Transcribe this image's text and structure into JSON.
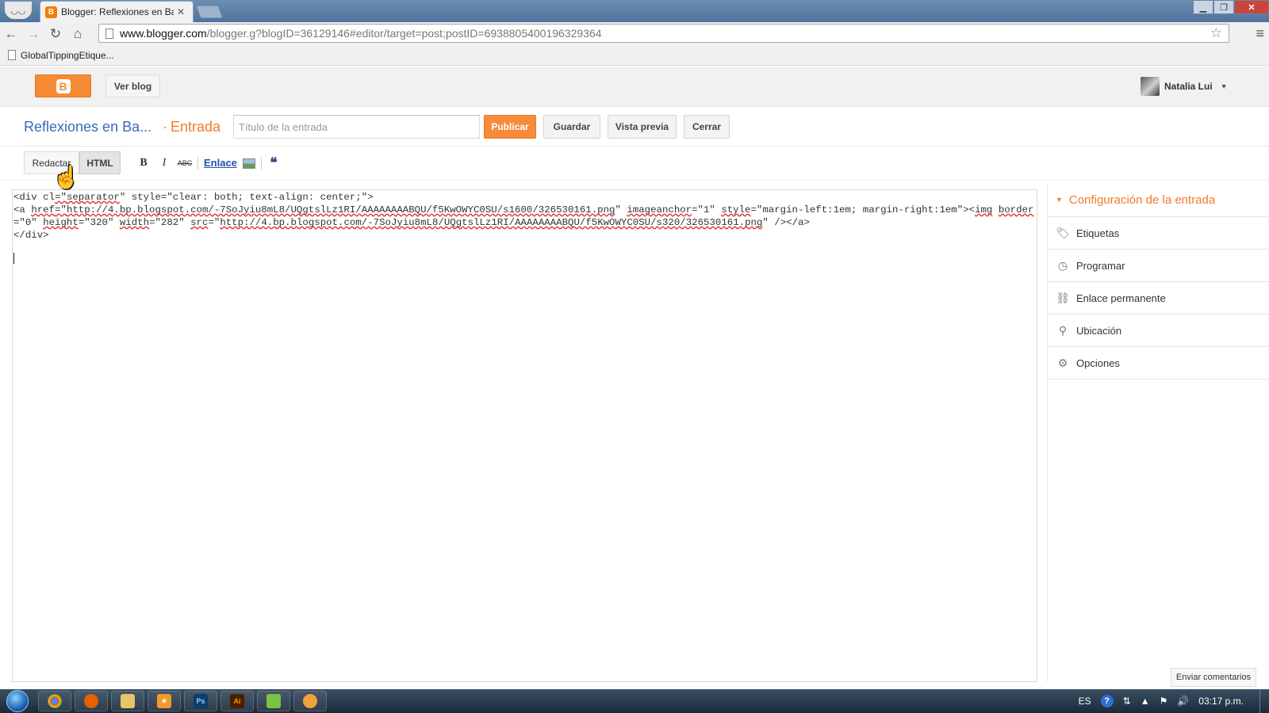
{
  "browser": {
    "tab_title": "Blogger: Reflexiones en Ba",
    "url_host": "www.blogger.com",
    "url_path": "/blogger.g?blogID=36129146#editor/target=post;postID=6938805400196329364",
    "bookmark": "GlobalTippingEtique..."
  },
  "header": {
    "view_blog": "Ver blog",
    "user_name": "Natalia Lui"
  },
  "post_bar": {
    "blog_name": "Reflexiones en Ba...",
    "separator": "·",
    "post_type": "Entrada",
    "title_placeholder": "Título de la entrada",
    "title_value": "",
    "publish": "Publicar",
    "save": "Guardar",
    "preview": "Vista previa",
    "close": "Cerrar"
  },
  "editor_toolbar": {
    "compose": "Redactar",
    "html": "HTML",
    "bold": "B",
    "italic": "I",
    "strike": "ABC",
    "link": "Enlace",
    "quote": "❝"
  },
  "source": {
    "l1a": "<div cl",
    "l1b": "=\"",
    "l1c": "separator",
    "l1d": "\" style=\"clear: both; text-align: center;\">\n<a ",
    "href_attr": "href",
    "q1": "=\"",
    "url1": "http://4.bp.blogspot.com/-7SoJyiu8mL8/UQgtslLz1RI/AAAAAAAABQU/f5KwOWYC0SU/s1600/326530161.png",
    "q2": "\" ",
    "imageanchor": "imageanchor",
    "q3": "=\"1\" ",
    "style_attr": "style",
    "style_val": "=\"margin-left:1em; margin-right:1em\"><",
    "img_tag": "img",
    "sp1": " ",
    "border_attr": "border",
    "border_val": "=\"0\" ",
    "height_attr": "height",
    "height_val": "=\"320\" ",
    "width_attr": "width",
    "width_val": "=\"282\" ",
    "src_attr": "src",
    "q4": "=\"",
    "url2": "http://4.bp.blogspot.com/-7SoJyiu8mL8/UQgtslLz1RI/AAAAAAAABQU/f5KwOWYC0SU/s320/326530161.png",
    "end": "\" /></a>\n</div>"
  },
  "sidebar": {
    "title": "Configuración de la entrada",
    "items": [
      {
        "label": "Etiquetas",
        "icon": "tag-icon"
      },
      {
        "label": "Programar",
        "icon": "clock-icon"
      },
      {
        "label": "Enlace permanente",
        "icon": "link-icon"
      },
      {
        "label": "Ubicación",
        "icon": "location-pin-icon"
      },
      {
        "label": "Opciones",
        "icon": "gear-icon"
      }
    ]
  },
  "feedback": "Enviar comentarios",
  "taskbar": {
    "language": "ES",
    "help": "?",
    "clock": "03:17 p.m."
  },
  "colors": {
    "blogger_orange": "#f68b3c",
    "link_blue": "#3a6ab7",
    "accent_orange": "#f37a27"
  }
}
